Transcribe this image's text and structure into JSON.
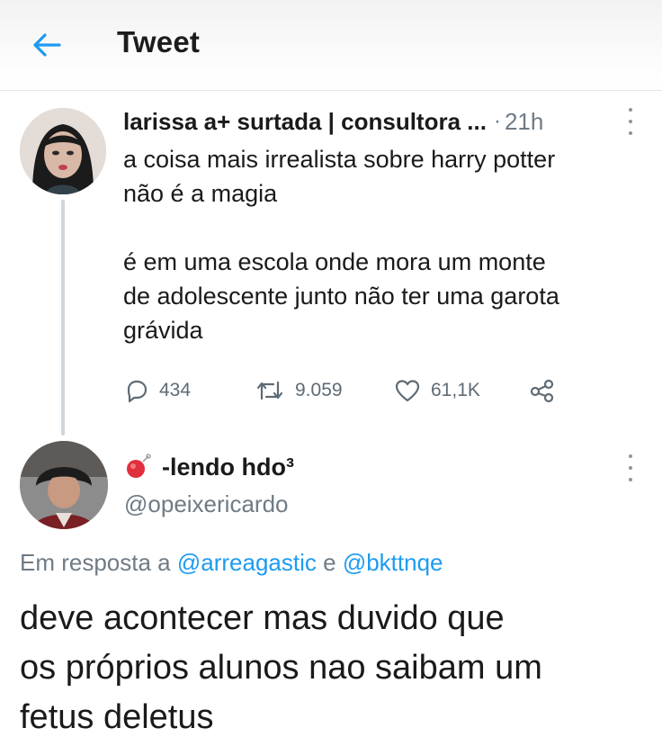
{
  "header": {
    "title": "Tweet",
    "back_icon": "arrow-left-icon",
    "accent_color": "#1d9bf0"
  },
  "tweet1": {
    "display_name": "larissa a+ surtada | consultora ...",
    "separator": "·",
    "time": "21h",
    "text_lines": [
      "a coisa mais irrealista sobre harry potter",
      "não é a magia",
      "é em uma escola onde mora um monte",
      "de adolescente junto não ter uma garota",
      "grávida"
    ],
    "actions": {
      "reply_count": "434",
      "retweet_count": "9.059",
      "like_count": "61,1K"
    }
  },
  "tweet2": {
    "display_name": "-lendo hdo³",
    "handle": "@opeixericardo",
    "reply_prefix": "Em resposta a",
    "mention_1": "@arreagastic",
    "reply_joiner": "e",
    "mention_2": "@bkttnqe",
    "text_lines": [
      "deve acontecer mas duvido que",
      "os próprios alunos nao saibam um",
      "fetus deletus"
    ]
  }
}
